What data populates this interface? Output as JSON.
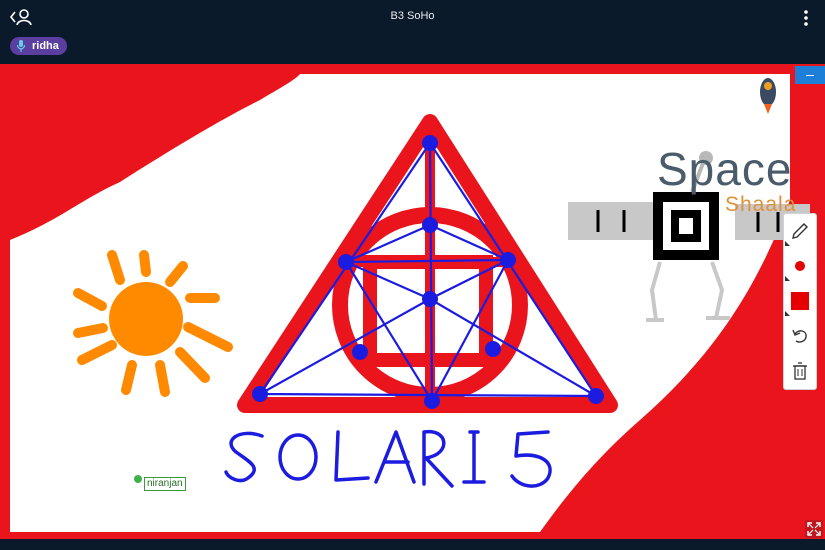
{
  "header": {
    "title": "B3 SoHo"
  },
  "participant": {
    "name": "ridha"
  },
  "board": {
    "drawn_text": "SOLARIS",
    "cursor_label": "niranjan",
    "logo": {
      "word1": "Space",
      "word2": "Shaala"
    }
  },
  "toolbar": {
    "tools": [
      "pencil-icon",
      "dot-color-icon",
      "fill-color-icon",
      "undo-icon",
      "trash-icon"
    ]
  },
  "colors": {
    "accent": "#1e7fd8",
    "board_red": "#e9141c",
    "ink_blue": "#1c1ce0",
    "sun_orange": "#ff8a00"
  }
}
